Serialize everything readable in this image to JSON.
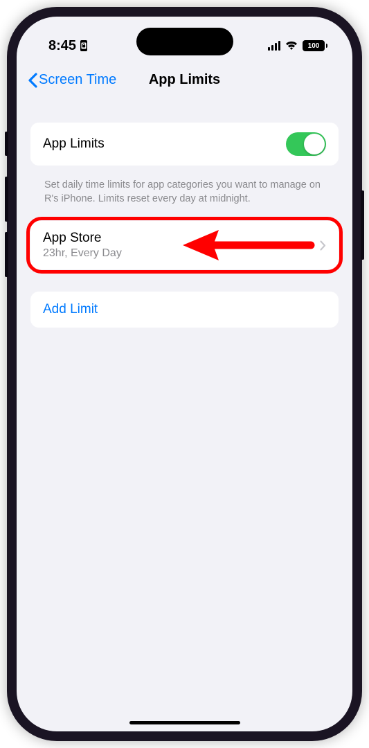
{
  "status": {
    "time": "8:45",
    "battery": "100"
  },
  "nav": {
    "back_label": "Screen Time",
    "title": "App Limits"
  },
  "toggle_row": {
    "label": "App Limits"
  },
  "description": "Set daily time limits for app categories you want to manage on R's iPhone. Limits reset every day at midnight.",
  "limit": {
    "name": "App Store",
    "detail": "23hr, Every Day"
  },
  "add_limit": {
    "label": "Add Limit"
  }
}
